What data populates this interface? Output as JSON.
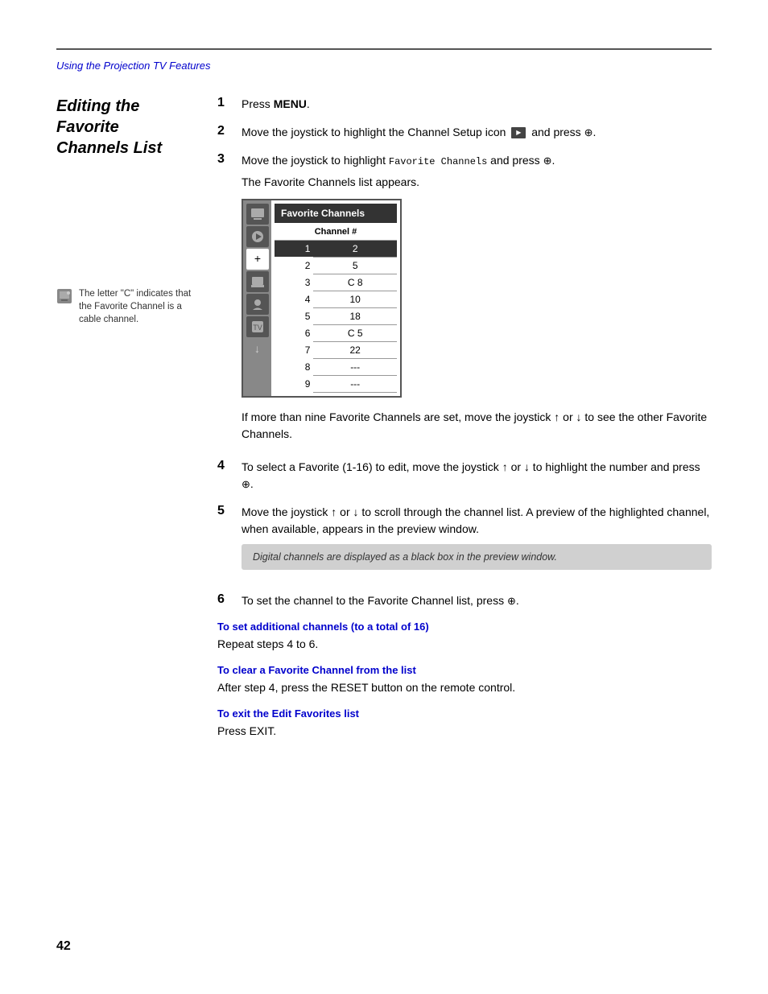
{
  "page": {
    "number": "42",
    "section_title": "Using the Projection TV Features"
  },
  "heading": {
    "title_line1": "Editing the Favorite",
    "title_line2": "Channels List"
  },
  "note": {
    "text": "The letter \"C\" indicates that the Favorite Channel is a cable channel."
  },
  "steps": [
    {
      "number": "1",
      "text": "Press MENU."
    },
    {
      "number": "2",
      "text": "Move the joystick to highlight the Channel Setup icon",
      "text2": "and press ⊕."
    },
    {
      "number": "3",
      "text": "Move the joystick to highlight Favorite Channels and press ⊕.",
      "note": "The Favorite Channels list appears."
    },
    {
      "number": "4",
      "text": "To select a Favorite (1-16) to edit, move the joystick ↑ or ↓ to highlight the number and press ⊕."
    },
    {
      "number": "5",
      "text": "Move the joystick ↑ or ↓ to scroll through the channel list. A preview of the highlighted channel, when available, appears in the preview window.",
      "info": "Digital channels are displayed as a black box in the preview window."
    },
    {
      "number": "6",
      "text": "To set the channel to the Favorite Channel list, press ⊕."
    }
  ],
  "sub_sections": [
    {
      "heading": "To set additional channels (to a total of 16)",
      "content": "Repeat steps 4 to 6."
    },
    {
      "heading": "To clear a Favorite Channel from the list",
      "content": "After step 4, press the RESET button on the remote control."
    },
    {
      "heading": "To exit the Edit Favorites list",
      "content": "Press EXIT."
    }
  ],
  "fav_channels_table": {
    "title": "Favorite Channels",
    "col_header": "Channel #",
    "rows": [
      {
        "num": "1",
        "ch": "2",
        "selected": true
      },
      {
        "num": "2",
        "ch": "5",
        "selected": false
      },
      {
        "num": "3",
        "ch": "C 8",
        "selected": false
      },
      {
        "num": "4",
        "ch": "10",
        "selected": false
      },
      {
        "num": "5",
        "ch": "18",
        "selected": false
      },
      {
        "num": "6",
        "ch": "C 5",
        "selected": false
      },
      {
        "num": "7",
        "ch": "22",
        "selected": false
      },
      {
        "num": "8",
        "ch": "---",
        "selected": false
      },
      {
        "num": "9",
        "ch": "---",
        "selected": false
      }
    ]
  },
  "more_channels_text": "If more than nine Favorite Channels are set, move the joystick ↑ or ↓ to see the other Favorite Channels."
}
